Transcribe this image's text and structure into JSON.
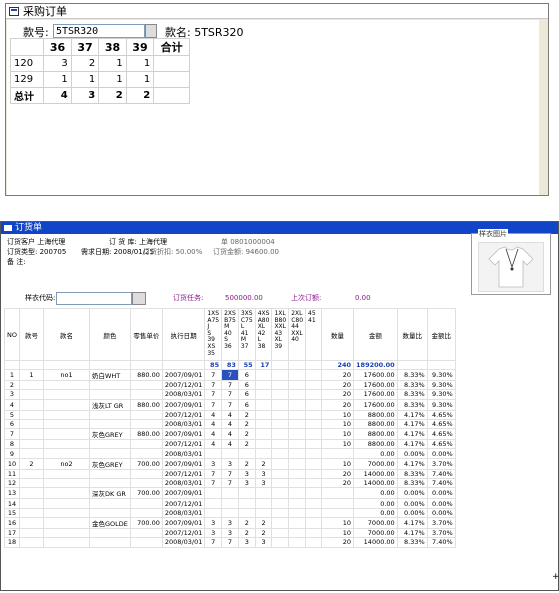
{
  "win1": {
    "title": "采购订单",
    "style_no_label": "款号:",
    "style_no_value": "5TSR320",
    "style_name_label": "款名: 5TSR320",
    "grid": {
      "headers": [
        "",
        "36",
        "37",
        "38",
        "39",
        "合计"
      ],
      "rows": [
        {
          "c0": "120",
          "c1": "3",
          "c2": "2",
          "c3": "1",
          "c4": "1",
          "c5": ""
        },
        {
          "c0": "129",
          "c1": "1",
          "c2": "1",
          "c3": "1",
          "c4": "1",
          "c5": ""
        },
        {
          "c0": "总计",
          "c1": "4",
          "c2": "3",
          "c3": "2",
          "c4": "2",
          "c5": ""
        }
      ]
    }
  },
  "win2": {
    "title": "订货单",
    "info": {
      "customer_label": "订货客户 上海代理",
      "warehouse_label": "订 货 库: 上海代理",
      "no_label": "单 0801000004",
      "type_label": "订货类型: 200705",
      "date_label": "需求日期: 2008/01/25",
      "discount_label": "订货折扣: 50.00%",
      "amount_label": "订货金额: 94600.00",
      "remark_label": "备    注:"
    },
    "image_legend": "样衣图片",
    "sample_label": "样衣代码:",
    "order_task_label": "订货任务:",
    "order_task_value": "500000.00",
    "last_order_label": "上次订额:",
    "last_order_value": "0.00",
    "headers": {
      "no": "NO",
      "style_no": "款号",
      "style_name": "款名",
      "color": "颜色",
      "price": "零售单价",
      "exec_date": "执行日期",
      "qty": "数量",
      "amount": "金额",
      "qty_ratio": "数量比",
      "amount_ratio": "金额比",
      "sizes": [
        [
          "1XS",
          "A75",
          "J",
          "S",
          "39",
          "XS",
          "35"
        ],
        [
          "2XS",
          "B75",
          "",
          "M",
          "40",
          "S",
          "36"
        ],
        [
          "3XS",
          "C75",
          "",
          "L",
          "41",
          "M",
          "37"
        ],
        [
          "4XS",
          "A80",
          "",
          "XL",
          "42",
          "L",
          "38"
        ],
        [
          "1XL",
          "B80",
          "",
          "XXL",
          "43",
          "XL",
          "39"
        ],
        [
          "2XL",
          "C80",
          "",
          "",
          "44",
          "XXL",
          "40"
        ],
        [
          "",
          "",
          "",
          "",
          "45",
          "",
          "41"
        ]
      ]
    },
    "sum_row": {
      "s1": "85",
      "s2": "83",
      "s3": "55",
      "s4": "17",
      "qty": "240",
      "amount": "189200.00"
    },
    "rows": [
      {
        "no": "1",
        "sno": "1",
        "sname": "no1",
        "color": "奶白WHT",
        "price": "880.00",
        "date": "2007/09/01",
        "s1": "7",
        "s2": "7",
        "s3": "6",
        "s4": "",
        "qty": "20",
        "amount": "17600.00",
        "qr": "8.33%",
        "ar": "9.30%"
      },
      {
        "no": "2",
        "sno": "",
        "sname": "",
        "color": "",
        "price": "",
        "date": "2007/12/01",
        "s1": "7",
        "s2": "7",
        "s3": "6",
        "s4": "",
        "qty": "20",
        "amount": "17600.00",
        "qr": "8.33%",
        "ar": "9.30%"
      },
      {
        "no": "3",
        "sno": "",
        "sname": "",
        "color": "",
        "price": "",
        "date": "2008/03/01",
        "s1": "7",
        "s2": "7",
        "s3": "6",
        "s4": "",
        "qty": "20",
        "amount": "17600.00",
        "qr": "8.33%",
        "ar": "9.30%"
      },
      {
        "no": "4",
        "sno": "",
        "sname": "",
        "color": "浅灰LT GR",
        "price": "880.00",
        "date": "2007/09/01",
        "s1": "7",
        "s2": "7",
        "s3": "6",
        "s4": "",
        "qty": "20",
        "amount": "17600.00",
        "qr": "8.33%",
        "ar": "9.30%"
      },
      {
        "no": "5",
        "sno": "",
        "sname": "",
        "color": "",
        "price": "",
        "date": "2007/12/01",
        "s1": "4",
        "s2": "4",
        "s3": "2",
        "s4": "",
        "qty": "10",
        "amount": "8800.00",
        "qr": "4.17%",
        "ar": "4.65%"
      },
      {
        "no": "6",
        "sno": "",
        "sname": "",
        "color": "",
        "price": "",
        "date": "2008/03/01",
        "s1": "4",
        "s2": "4",
        "s3": "2",
        "s4": "",
        "qty": "10",
        "amount": "8800.00",
        "qr": "4.17%",
        "ar": "4.65%"
      },
      {
        "no": "7",
        "sno": "",
        "sname": "",
        "color": "灰色GREY",
        "price": "880.00",
        "date": "2007/09/01",
        "s1": "4",
        "s2": "4",
        "s3": "2",
        "s4": "",
        "qty": "10",
        "amount": "8800.00",
        "qr": "4.17%",
        "ar": "4.65%"
      },
      {
        "no": "8",
        "sno": "",
        "sname": "",
        "color": "",
        "price": "",
        "date": "2007/12/01",
        "s1": "4",
        "s2": "4",
        "s3": "2",
        "s4": "",
        "qty": "10",
        "amount": "8800.00",
        "qr": "4.17%",
        "ar": "4.65%"
      },
      {
        "no": "9",
        "sno": "",
        "sname": "",
        "color": "",
        "price": "",
        "date": "2008/03/01",
        "s1": "",
        "s2": "",
        "s3": "",
        "s4": "",
        "qty": "",
        "amount": "0.00",
        "qr": "0.00%",
        "ar": "0.00%"
      },
      {
        "no": "10",
        "sno": "2",
        "sname": "no2",
        "color": "灰色GREY",
        "price": "700.00",
        "date": "2007/09/01",
        "s1": "3",
        "s2": "3",
        "s3": "2",
        "s4": "2",
        "qty": "10",
        "amount": "7000.00",
        "qr": "4.17%",
        "ar": "3.70%"
      },
      {
        "no": "11",
        "sno": "",
        "sname": "",
        "color": "",
        "price": "",
        "date": "2007/12/01",
        "s1": "7",
        "s2": "7",
        "s3": "3",
        "s4": "3",
        "qty": "20",
        "amount": "14000.00",
        "qr": "8.33%",
        "ar": "7.40%"
      },
      {
        "no": "12",
        "sno": "",
        "sname": "",
        "color": "",
        "price": "",
        "date": "2008/03/01",
        "s1": "7",
        "s2": "7",
        "s3": "3",
        "s4": "3",
        "qty": "20",
        "amount": "14000.00",
        "qr": "8.33%",
        "ar": "7.40%"
      },
      {
        "no": "13",
        "sno": "",
        "sname": "",
        "color": "深灰DK GR",
        "price": "700.00",
        "date": "2007/09/01",
        "s1": "",
        "s2": "",
        "s3": "",
        "s4": "",
        "qty": "",
        "amount": "0.00",
        "qr": "0.00%",
        "ar": "0.00%"
      },
      {
        "no": "14",
        "sno": "",
        "sname": "",
        "color": "",
        "price": "",
        "date": "2007/12/01",
        "s1": "",
        "s2": "",
        "s3": "",
        "s4": "",
        "qty": "",
        "amount": "0.00",
        "qr": "0.00%",
        "ar": "0.00%"
      },
      {
        "no": "15",
        "sno": "",
        "sname": "",
        "color": "",
        "price": "",
        "date": "2008/03/01",
        "s1": "",
        "s2": "",
        "s3": "",
        "s4": "",
        "qty": "",
        "amount": "0.00",
        "qr": "0.00%",
        "ar": "0.00%"
      },
      {
        "no": "16",
        "sno": "",
        "sname": "",
        "color": "金色GOLDE",
        "price": "700.00",
        "date": "2007/09/01",
        "s1": "3",
        "s2": "3",
        "s3": "2",
        "s4": "2",
        "qty": "10",
        "amount": "7000.00",
        "qr": "4.17%",
        "ar": "3.70%"
      },
      {
        "no": "17",
        "sno": "",
        "sname": "",
        "color": "",
        "price": "",
        "date": "2007/12/01",
        "s1": "3",
        "s2": "3",
        "s3": "2",
        "s4": "2",
        "qty": "10",
        "amount": "7000.00",
        "qr": "4.17%",
        "ar": "3.70%"
      },
      {
        "no": "18",
        "sno": "",
        "sname": "",
        "color": "",
        "price": "",
        "date": "2008/03/01",
        "s1": "7",
        "s2": "7",
        "s3": "3",
        "s4": "3",
        "qty": "20",
        "amount": "14000.00",
        "qr": "8.33%",
        "ar": "7.40%"
      }
    ]
  }
}
